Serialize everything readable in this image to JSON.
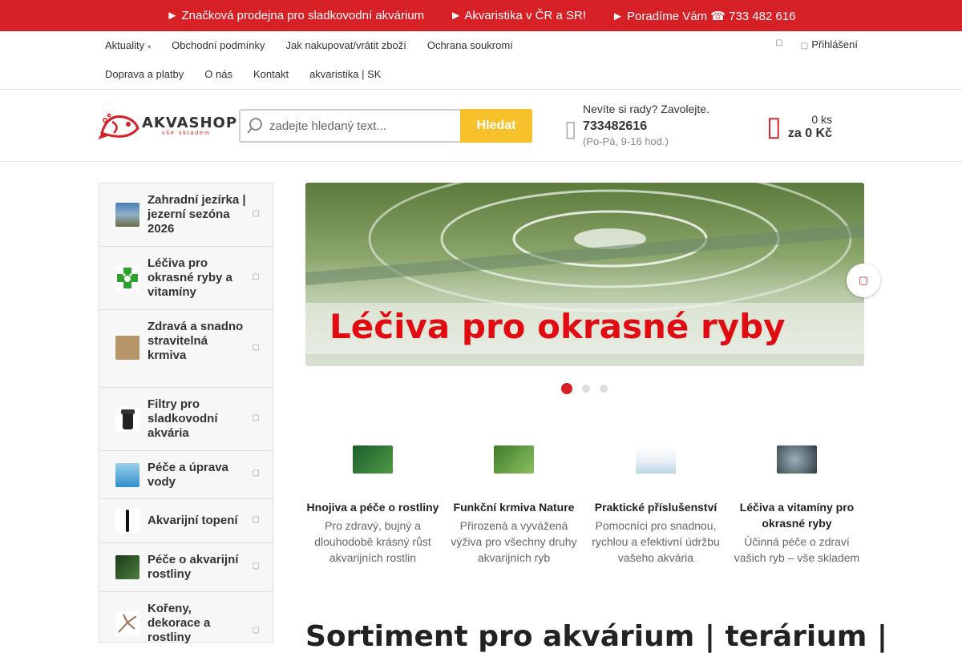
{
  "topbar": {
    "items": [
      "► Značková prodejna pro sladkovodní akvárium",
      "► Akvaristika v ČR a SR!",
      "► Poradíme Vám ☎ 733 482 616"
    ]
  },
  "nav": {
    "row1": [
      "Aktuality",
      "Obchodní podmínky",
      "Jak nakupovat/vrátit zboží",
      "Ochrana soukromí"
    ],
    "row2": [
      "Doprava a platby",
      "O nás",
      "Kontakt",
      "akvaristika | SK"
    ],
    "login": "Přihlášení"
  },
  "logo": {
    "name": "AKVASHOP",
    "tagline": "vše skladem"
  },
  "search": {
    "placeholder": "zadejte hledaný text...",
    "button": "Hledat"
  },
  "contact": {
    "question": "Nevíte si rady? Zavolejte.",
    "phone": "733482616",
    "hours": "(Po-Pá, 9-16 hod.)"
  },
  "cart": {
    "qty": "0 ks",
    "price": "za 0 Kč"
  },
  "categories": [
    "Zahradní jezírka | jezerní sezóna 2026",
    "Léčiva pro okrasné ryby a vitamíny",
    "Zdravá a snadno stravitelná krmiva",
    "Filtry pro sladkovodní akvária",
    "Péče a úprava vody",
    "Akvarijní topení",
    "Péče o akvarijní rostliny",
    "Kořeny, dekorace a rostliny"
  ],
  "banner": {
    "text": "Léčiva pro okrasné ryby",
    "slide": 1,
    "slides": 3
  },
  "features": [
    {
      "title": "Hnojiva a péče o rostliny",
      "desc": "Pro zdravý, bujný a dlouhodobě krásný růst akvarijních rostlin"
    },
    {
      "title": "Funkční krmiva Nature",
      "desc": "Přirozená a vyvážená výživa pro všechny druhy akvarijních ryb"
    },
    {
      "title": "Praktické příslušenství",
      "desc": "Pomocníci pro snadnou, rychlou a efektivní údržbu vašeho akvária"
    },
    {
      "title": "Léčiva a vitamíny pro okrasné ryby",
      "desc": "Účinná péče o zdraví vašich ryb – vše skladem"
    }
  ],
  "section": {
    "title": "Sortiment pro akvárium | terárium |"
  },
  "icons": {
    "search": "search-icon",
    "phone": "phone-icon",
    "cart": "cart-icon",
    "next": "chevron-right-icon",
    "login": "user-icon"
  },
  "colors": {
    "brand": "#d71f26",
    "button": "#f6c12a"
  }
}
